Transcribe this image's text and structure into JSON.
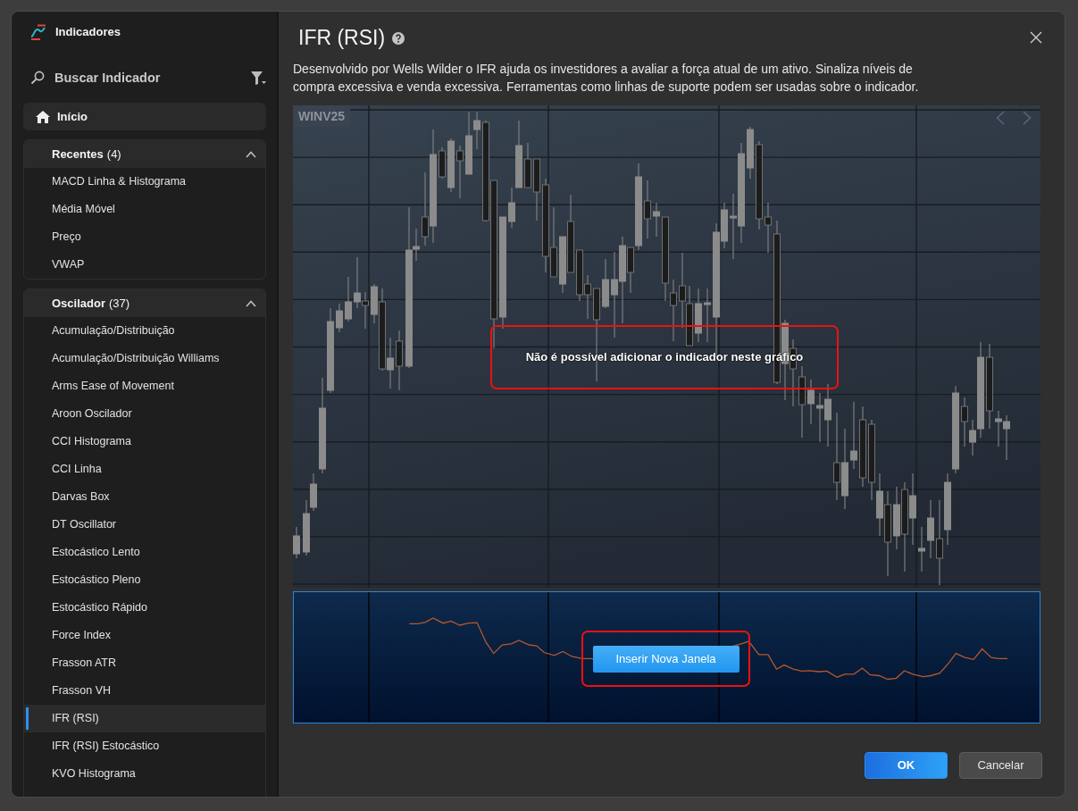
{
  "window": {
    "title": "Indicadores"
  },
  "sidebar": {
    "search": {
      "placeholder": "Buscar Indicador"
    },
    "home": {
      "label": "Início"
    },
    "groups": [
      {
        "title": "Recentes",
        "count": "(4)",
        "expanded": true,
        "items": [
          {
            "label": "MACD Linha & Histograma",
            "selected": false
          },
          {
            "label": "Média Móvel",
            "selected": false
          },
          {
            "label": "Preço",
            "selected": false
          },
          {
            "label": "VWAP",
            "selected": false
          }
        ]
      },
      {
        "title": "Oscilador",
        "count": "(37)",
        "expanded": true,
        "items": [
          {
            "label": "Acumulação/Distribuição",
            "selected": false
          },
          {
            "label": "Acumulação/Distribuição Williams",
            "selected": false
          },
          {
            "label": "Arms Ease of Movement",
            "selected": false
          },
          {
            "label": "Aroon Oscilador",
            "selected": false
          },
          {
            "label": "CCI Histograma",
            "selected": false
          },
          {
            "label": "CCI Linha",
            "selected": false
          },
          {
            "label": "Darvas Box",
            "selected": false
          },
          {
            "label": "DT Oscillator",
            "selected": false
          },
          {
            "label": "Estocástico Lento",
            "selected": false
          },
          {
            "label": "Estocástico Pleno",
            "selected": false
          },
          {
            "label": "Estocástico Rápido",
            "selected": false
          },
          {
            "label": "Force Index",
            "selected": false
          },
          {
            "label": "Frasson ATR",
            "selected": false
          },
          {
            "label": "Frasson VH",
            "selected": false
          },
          {
            "label": "IFR (RSI)",
            "selected": true
          },
          {
            "label": "IFR (RSI) Estocástico",
            "selected": false
          },
          {
            "label": "KVO Histograma",
            "selected": false
          }
        ]
      }
    ]
  },
  "detail": {
    "title": "IFR (RSI)",
    "description": "Desenvolvido por Wells Wilder o IFR ajuda os investidores a avaliar a força atual de um ativo. Sinaliza níveis de compra excessiva e venda excessiva. Ferramentas como linhas de suporte podem ser usadas sobre o indicador.",
    "chart": {
      "symbol": "WINV25",
      "message": {
        "text": "Não é possível adicionar o indicador neste gráfico",
        "highlighted": true
      }
    },
    "indicator_pane": {
      "button": {
        "label": "Inserir Nova Janela",
        "highlighted": true
      }
    }
  },
  "buttons": [
    {
      "label": "OK",
      "kind": "primary"
    },
    {
      "label": "Cancelar",
      "kind": "secondary"
    }
  ]
}
